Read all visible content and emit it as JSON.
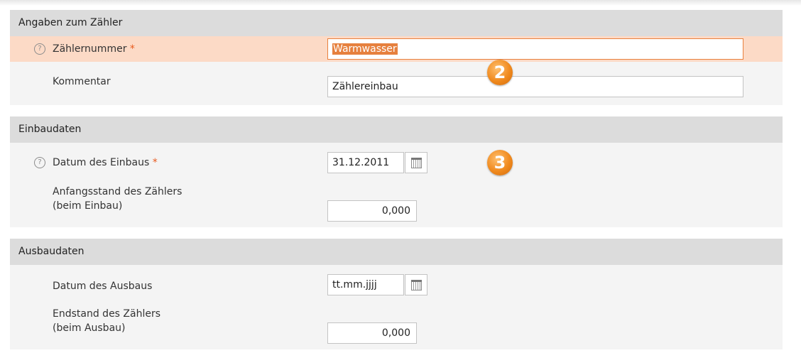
{
  "sections": {
    "meter": {
      "header": "Angaben zum Zähler",
      "meter_number": {
        "label": "Zählernummer",
        "required_mark": "*",
        "value": "Warmwasser"
      },
      "comment": {
        "label": "Kommentar",
        "value": "Zählereinbau"
      }
    },
    "installation": {
      "header": "Einbaudaten",
      "date": {
        "label": "Datum des Einbaus",
        "required_mark": "*",
        "value": "31.12.2011"
      },
      "initial_reading": {
        "label_line1": "Anfangsstand des Zählers",
        "label_line2": "(beim Einbau)",
        "value": "0,000"
      }
    },
    "removal": {
      "header": "Ausbaudaten",
      "date": {
        "label": "Datum des Ausbaus",
        "value": "tt.mm.jjjj"
      },
      "final_reading": {
        "label_line1": "Endstand des Zählers",
        "label_line2": "(beim Ausbau)",
        "value": "0,000"
      }
    }
  },
  "badges": {
    "step2": "2",
    "step3": "3"
  },
  "icons": {
    "help": "question-circle-icon",
    "calendar": "calendar-icon"
  },
  "colors": {
    "accent": "#e8803e",
    "highlight_row": "#fcdac6",
    "required": "#e85a1e"
  }
}
